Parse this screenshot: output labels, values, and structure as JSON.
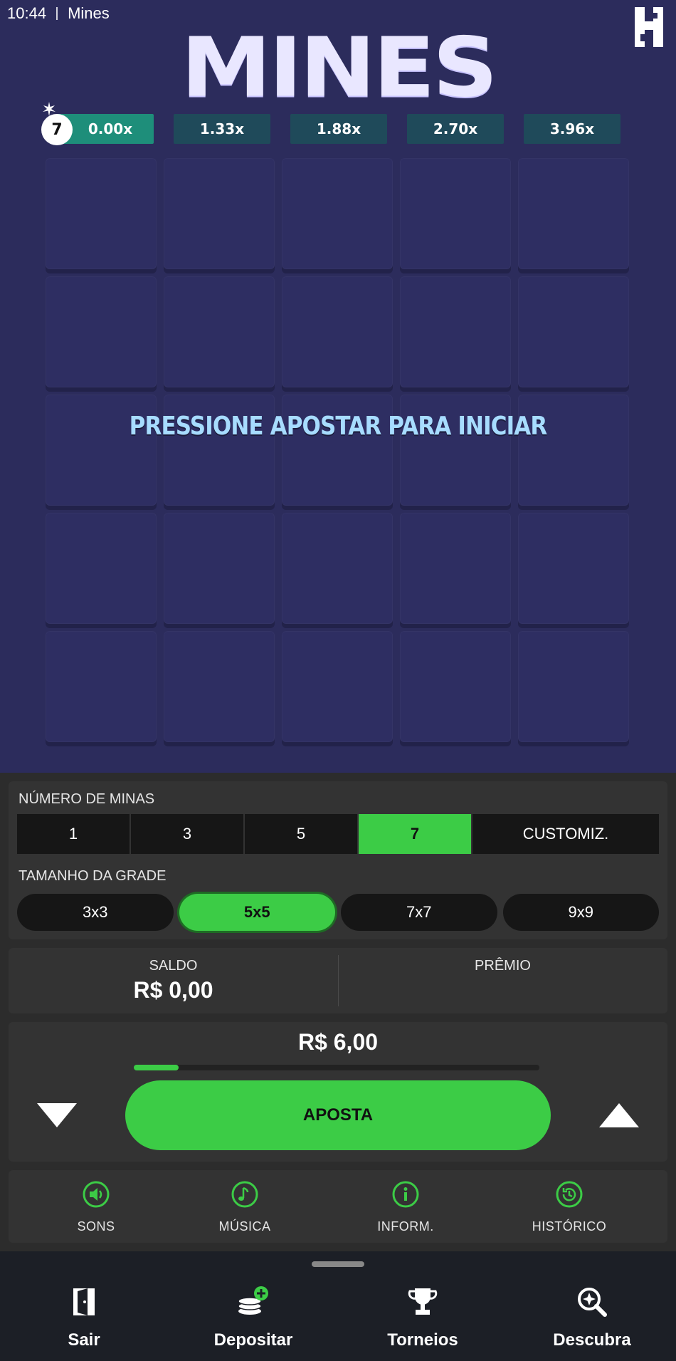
{
  "statusbar": {
    "time": "10:44",
    "app_name": "Mines"
  },
  "game": {
    "title": "MINES",
    "mine_count_badge": "7",
    "multipliers": [
      "0.00x",
      "1.33x",
      "1.88x",
      "2.70x",
      "3.96x"
    ],
    "prompt": "PRESSIONE APOSTAR PARA INICIAR",
    "grid_size": 5
  },
  "mines_panel": {
    "label": "NÚMERO DE MINAS",
    "options": [
      "1",
      "3",
      "5",
      "7",
      "CUSTOMIZ."
    ],
    "selected": "7"
  },
  "grid_panel": {
    "label": "TAMANHO DA GRADE",
    "options": [
      "3x3",
      "5x5",
      "7x7",
      "9x9"
    ],
    "selected": "5x5"
  },
  "balance": {
    "saldo_label": "SALDO",
    "saldo_value": "R$ 0,00",
    "premio_label": "PRÊMIO"
  },
  "bet": {
    "amount": "R$ 6,00",
    "progress_fraction": 0.11,
    "button_label": "APOSTA"
  },
  "options_bar": [
    {
      "label": "SONS",
      "icon": "speaker-icon"
    },
    {
      "label": "MÚSICA",
      "icon": "music-note-icon"
    },
    {
      "label": "INFORM.",
      "icon": "info-icon"
    },
    {
      "label": "HISTÓRICO",
      "icon": "history-icon"
    }
  ],
  "bottom_nav": [
    {
      "label": "Sair",
      "icon": "exit-door-icon"
    },
    {
      "label": "Depositar",
      "icon": "coins-plus-icon"
    },
    {
      "label": "Torneios",
      "icon": "trophy-icon"
    },
    {
      "label": "Descubra",
      "icon": "discover-search-icon"
    }
  ],
  "colors": {
    "game_bg": "#2c2c5c",
    "accent_green": "#3ccc46",
    "multiplier_bg": "#1f4a5a",
    "multiplier_active": "#1e8e7a",
    "panel_bg": "#333333"
  }
}
